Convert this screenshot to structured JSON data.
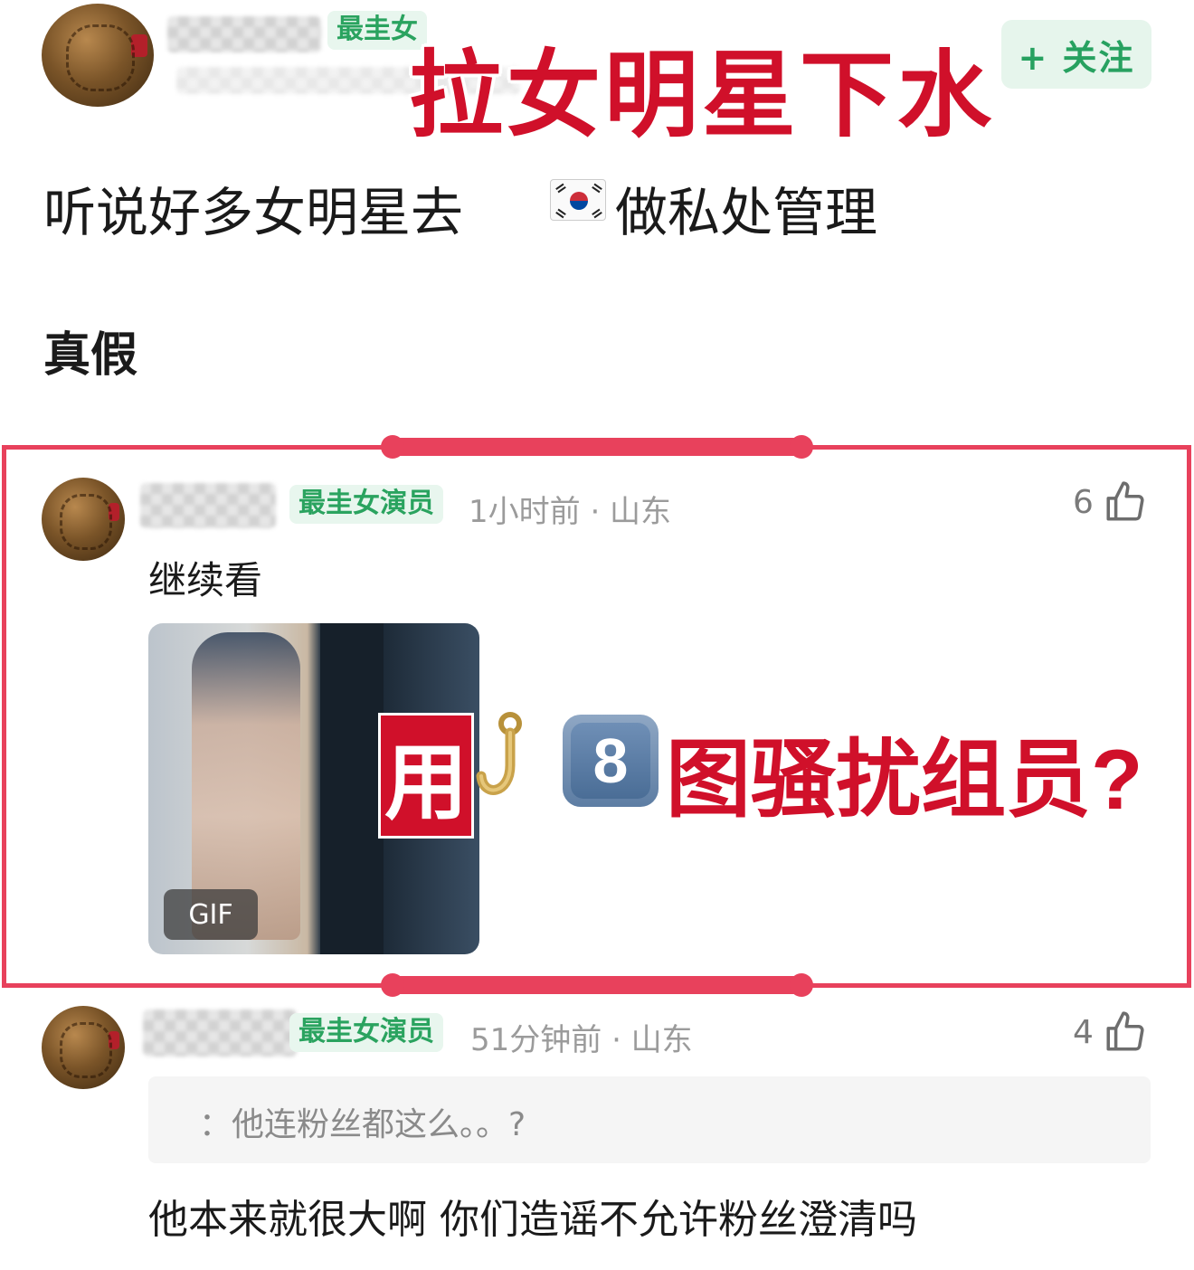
{
  "post": {
    "author_tag": "最圭女",
    "follow_label": "+ 关注",
    "overlay_title": "拉女明星下水",
    "line1_before": "听说好多女明星去",
    "line1_after": "做私处管理",
    "line2": "真假",
    "flag_icon": "korea-flag-icon"
  },
  "comment1": {
    "tag": "最圭女演员",
    "meta": "1小时前 · 山东",
    "likes": "6",
    "text": "继续看",
    "gif_label": "GIF",
    "overlay_prefix": "用",
    "overlay_number": "8",
    "overlay_suffix": "图骚扰组员?"
  },
  "comment2": {
    "tag": "最圭女演员",
    "meta": "51分钟前 · 山东",
    "likes": "4",
    "quote": "：他连粉丝都这么。。?",
    "text": "他本来就很大啊 你们造谣不允许粉丝澄清吗"
  },
  "colors": {
    "accent_red": "#d0102a",
    "highlight_border": "#e8415c",
    "tag_green": "#2aa35f"
  }
}
